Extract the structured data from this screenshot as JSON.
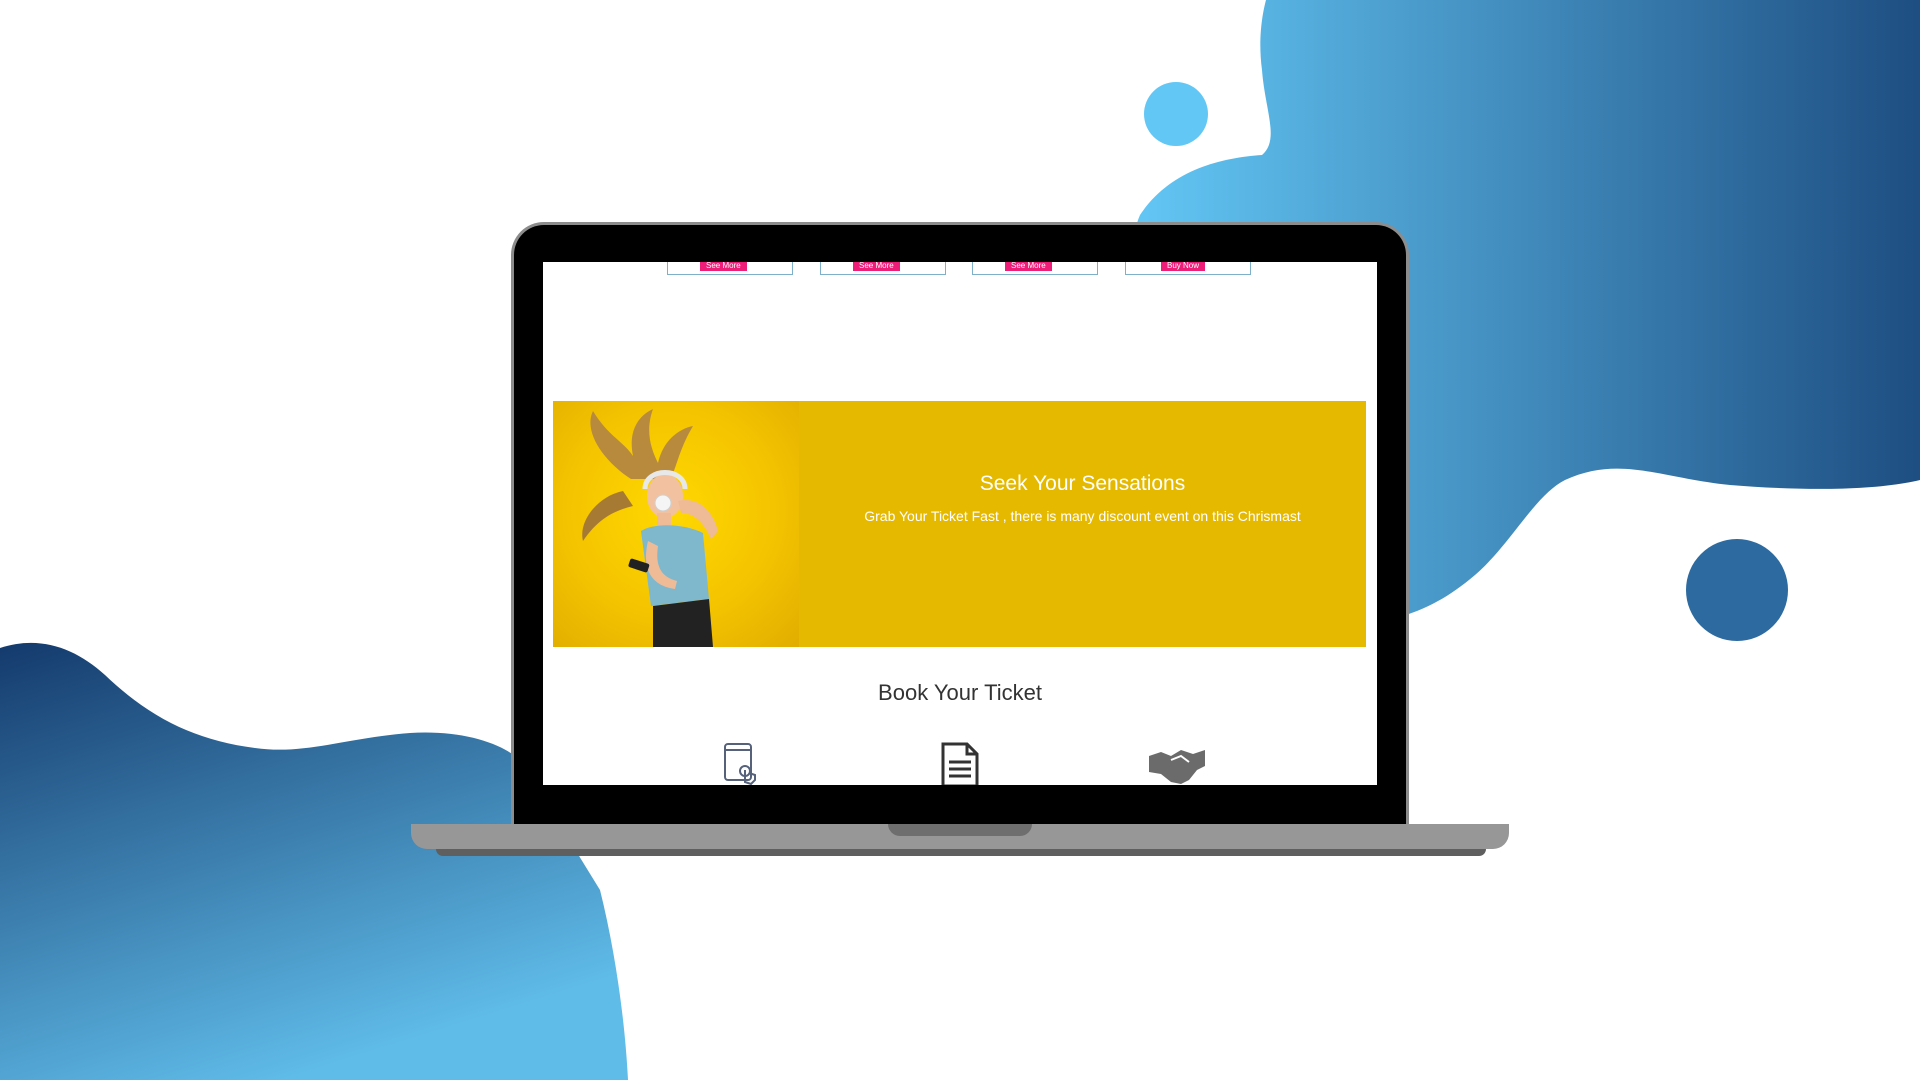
{
  "screen": {
    "cards": [
      {
        "button_label": "See More"
      },
      {
        "button_label": "See More"
      },
      {
        "button_label": "See More"
      },
      {
        "button_label": "Buy Now"
      }
    ],
    "banner": {
      "title": "Seek Your Sensations",
      "subtitle": "Grab Your Ticket Fast , there is many discount event on this Chrismast",
      "background_color": "#e5b900"
    },
    "booking": {
      "title": "Book Your Ticket",
      "steps": [
        {
          "icon": "tablet-touch-icon"
        },
        {
          "icon": "document-icon"
        },
        {
          "icon": "handshake-icon"
        }
      ]
    }
  },
  "colors": {
    "accent_button": "#ee1d78",
    "blob_light": "#63c7f5",
    "blob_dark": "#1e4e82"
  }
}
